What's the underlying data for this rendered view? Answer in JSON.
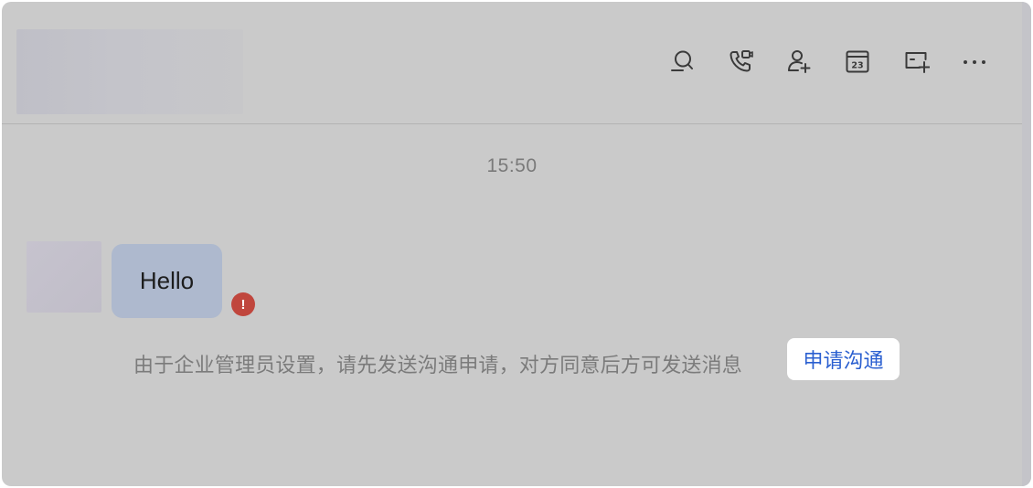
{
  "header": {
    "toolbar": [
      {
        "name": "search-chat-icon"
      },
      {
        "name": "phone-video-call-icon"
      },
      {
        "name": "add-member-icon"
      },
      {
        "name": "calendar-icon",
        "text": "23"
      },
      {
        "name": "new-screen-icon"
      },
      {
        "name": "more-icon"
      }
    ]
  },
  "chat": {
    "timestamp": "15:50",
    "message": {
      "text": "Hello",
      "status": "failed",
      "status_icon": "!"
    },
    "notice": "由于企业管理员设置，请先发送沟通申请，对方同意后方可发送消息",
    "request_button": "申请沟通"
  },
  "colors": {
    "overlay": "#cacaca",
    "bubble": "#aeb9ce",
    "error": "#c0463d",
    "link": "#2a5fd0"
  }
}
